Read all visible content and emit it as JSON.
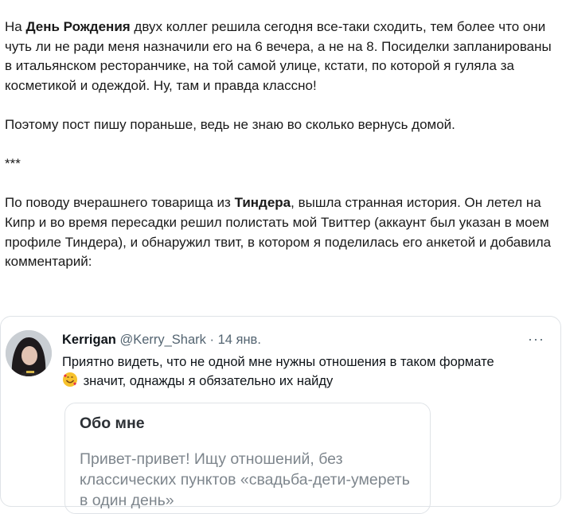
{
  "article": {
    "p1": {
      "pre": "На ",
      "bold": "День Рождения",
      "post": " двух коллег решила сегодня все-таки сходить, тем более что они чуть ли не ради меня назначили его на 6 вечера, а не на 8. Посиделки запланированы в итальянском ресторанчике, на той самой улице, кстати, по которой я гуляла за косметикой и одеждой. Ну, там и правда классно!"
    },
    "p2": "Поэтому пост пишу пораньше, ведь не знаю во сколько вернусь домой.",
    "separator": "***",
    "p3": {
      "pre": "По поводу вчерашнего товарища из ",
      "bold": "Тиндера",
      "post": ", вышла странная история. Он летел на Кипр и во время пересадки решил полистать мой Твиттер (аккаунт был указан в моем профиле Тиндера), и обнаружил твит, в котором я поделилась его анкетой и добавила комментарий:"
    }
  },
  "tweet": {
    "author": "Kerrigan",
    "handle": "@Kerry_Shark",
    "dot": " · ",
    "date": "14 янв.",
    "more_icon": "···",
    "text_line1": "Приятно видеть, что не одной мне нужны отношения в таком формате",
    "emoji": "smiling-face-with-hearts-icon",
    "text_line2": " значит, однажды я обязательно их найду",
    "card": {
      "title": "Обо мне",
      "body": "Привет-привет! Ищу отношений, без классических пунктов «свадьба-дети-умереть в один день»"
    }
  },
  "colors": {
    "text": "#1a1a1a",
    "muted": "#536471",
    "card_text": "#7e868d",
    "border": "#dfe3e7"
  }
}
